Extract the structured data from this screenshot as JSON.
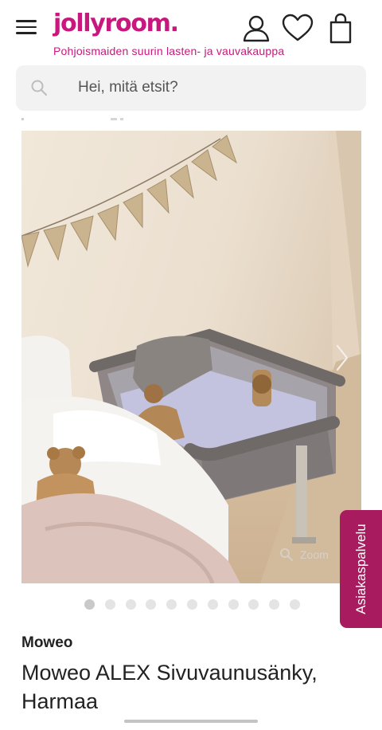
{
  "header": {
    "logo": "jollyroom.",
    "tagline": "Pohjoismaiden suurin lasten- ja vauvakauppa",
    "icons": [
      "menu-icon",
      "user-icon",
      "heart-icon",
      "shopping-bag-icon"
    ]
  },
  "search": {
    "placeholder": "Hei, mitä etsit?"
  },
  "gallery": {
    "zoom_label": "Zoom",
    "total_images": 11,
    "active_index": 0
  },
  "product": {
    "brand": "Moweo",
    "title": "Moweo ALEX Sivuvaunusänky, Harmaa"
  },
  "customer_service": {
    "label": "Asiakaspalvelu"
  },
  "colors": {
    "brand_pink": "#c8187e",
    "service_tab": "#a81c5f"
  }
}
